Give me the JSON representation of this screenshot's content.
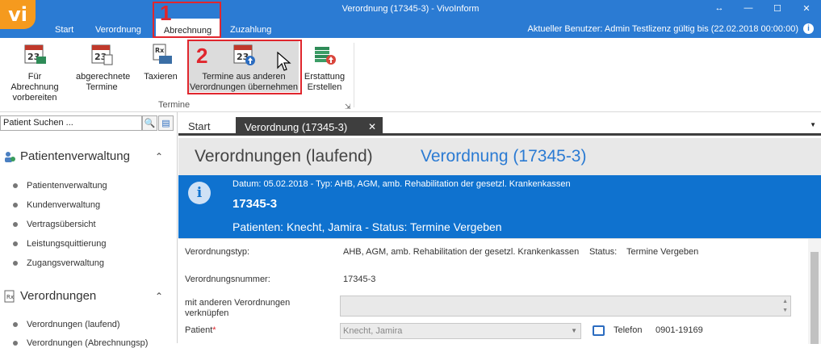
{
  "app": {
    "logo": "vi",
    "window_title": "Verordnung (17345-3) - VivoInform",
    "window_buttons": [
      "↔",
      "—",
      "☐",
      "✕"
    ],
    "menu_tabs": [
      "Start",
      "Verordnung",
      "Abrechnung",
      "Zuzahlung"
    ],
    "active_menu_tab": "Abrechnung",
    "current_user": "Aktueller Benutzer: Admin Testlizenz gültig bis (22.02.2018 00:00:00)",
    "info_icon": "i"
  },
  "ribbon": {
    "buttons": [
      {
        "line1": "Für Abrechnung",
        "line2": "vorbereiten",
        "icon": "calendar-money-icon"
      },
      {
        "line1": "abgerechnete",
        "line2": "Termine",
        "icon": "calendar-list-icon"
      },
      {
        "line1": "Taxieren",
        "line2": "",
        "icon": "rx-printer-icon"
      },
      {
        "line1": "Termine aus anderen",
        "line2": "Verordnungen übernehmen",
        "icon": "calendar-upload-icon"
      },
      {
        "line1": "Erstattung",
        "line2": "Erstellen",
        "icon": "money-refund-icon"
      }
    ],
    "group_label": "Termine",
    "group_launcher": "⇲",
    "calendar_number": "23"
  },
  "annotations": {
    "step1": "1",
    "step2": "2"
  },
  "sidebar": {
    "search_placeholder": "Patient Suchen ...",
    "search_icon": "🔍",
    "card_icon": "▤",
    "section1": {
      "title": "Patientenverwaltung",
      "items": [
        "Patientenverwaltung",
        "Kundenverwaltung",
        "Vertragsübersicht",
        "Leistungsquittierung",
        "Zugangsverwaltung"
      ]
    },
    "section2": {
      "title": "Verordnungen",
      "items": [
        "Verordnungen (laufend)",
        "Verordnungen (Abrechnungsp)"
      ]
    },
    "chevron": "⌃"
  },
  "tabs": {
    "start": "Start",
    "active": "Verordnung (17345-3)",
    "close": "✕",
    "dropdown": "▼"
  },
  "page": {
    "breadcrumb1": "Verordnungen (laufend)",
    "breadcrumb2": "Verordnung (17345-3)"
  },
  "banner": {
    "icon": "i",
    "line1": "Datum: 05.02.2018  -  Typ: AHB, AGM, amb. Rehabilitation der gesetzl. Krankenkassen",
    "id": "17345-3",
    "patient_status": "Patienten: Knecht, Jamira  -  Status: Termine Vergeben"
  },
  "form": {
    "type_label": "Verordnungstyp:",
    "type_value": "AHB, AGM, amb. Rehabilitation der gesetzl. Krankenkassen",
    "status_label": "Status:",
    "status_value": "Termine Vergeben",
    "number_label": "Verordnungsnummer:",
    "number_value": "17345-3",
    "link_label1": "mit anderen Verordnungen",
    "link_label2": "verknüpfen",
    "patient_label": "Patient",
    "required_mark": "*",
    "patient_value": "Knecht, Jamira",
    "combo_arrow": "▼",
    "phone_label": "Telefon",
    "phone_value": "0901-19169",
    "scroll_up": "▲",
    "scroll_down": "▼"
  },
  "colors": {
    "titlebar": "#2b7bd3",
    "banner": "#0f72cf",
    "logo": "#f59a1e",
    "annotation": "#e0262d"
  }
}
